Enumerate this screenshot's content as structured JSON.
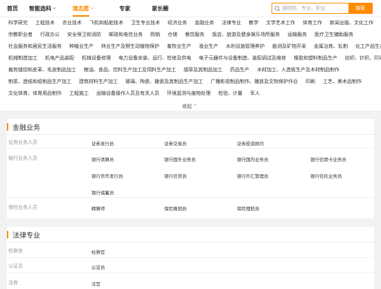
{
  "nav": {
    "items": [
      {
        "label": "首页"
      },
      {
        "label": "智能选科",
        "dropdown": true
      },
      {
        "label": "填志愿",
        "dropdown": true,
        "active": true
      },
      {
        "label": "专家"
      },
      {
        "label": "家长圈"
      }
    ]
  },
  "search": {
    "placeholder": "搜院校、专业、职业",
    "button_label": "搜索"
  },
  "categories": {
    "rows": [
      [
        "科学研究",
        "工程技术",
        "农业技术",
        "飞机和船舶技术",
        "卫生专业技术",
        "经济业务",
        "金融业务",
        "法律专业",
        "教学",
        "文学艺术工作",
        "体育工作",
        "新闻出版、文化工作"
      ],
      [
        "宗教职业者",
        "行政办公",
        "安全保卫和消防",
        "邮政和电信业务",
        "购销",
        "仓储",
        "餐饮服务",
        "饭店、旅游及健身娱乐场所服务",
        "运输服务",
        "医疗卫生辅助服务"
      ],
      [
        "社会服务和居民生活服务",
        "种植业生产",
        "林业生产及野生动植物保护",
        "畜牧业生产",
        "渔业生产",
        "水利设施管理养护",
        "勘测及矿物开采",
        "金属冶炼、轧制",
        "化工产品生产能力"
      ],
      [
        "机械制造加工",
        "机电产品装配",
        "机械设备修理",
        "电力设备安装、运行、检修及供电",
        "电子元器件与设备制造、装配调试及维修",
        "橡胶和塑料制品生产",
        "纺织、针织、印染"
      ],
      [
        "裁剪缝纫和皮革、毛皮制品加工",
        "粮油、食品、饮料生产加工及饲料生产加工",
        "烟草及其制品加工",
        "药品生产",
        "木材加工、人造板生产及木材制品制作"
      ],
      [
        "制浆、造纸和纸制品生产加工",
        "建筑材料生产加工",
        "玻璃、陶瓷、搪瓷及其制品生产加工",
        "广播影视制品制作、播放及文物保护作业",
        "印刷",
        "工艺、美术品制作"
      ],
      [
        "文化体育、体育用品制作",
        "工程施工",
        "运输设备操作人员及有关人员",
        "环境监测与废物处理",
        "检验、计量",
        "军人"
      ]
    ],
    "collapse_label": "收起"
  },
  "sections": [
    {
      "title": "金融业务",
      "groups": [
        {
          "label": "证券业务人员",
          "jobs": [
            "证券发行员",
            "证券交易员",
            "证券投资顾问"
          ]
        },
        {
          "label": "银行业务人员",
          "jobs": [
            "银行清算员",
            "银行国外业务员",
            "银行国内业务员",
            "银行信用卡业务员",
            "银行货币发行员",
            "银行信贷员",
            "银行外汇管理员",
            "银行信托业务员",
            "银行储蓄员"
          ]
        },
        {
          "label": "保险业务人员",
          "jobs": [
            "精算师",
            "保险推销员",
            "保险理赔员"
          ]
        }
      ]
    },
    {
      "title": "法律专业",
      "groups": [
        {
          "label": "检察官",
          "jobs": [
            "检察官"
          ]
        },
        {
          "label": "公证员",
          "jobs": [
            "公证员"
          ]
        },
        {
          "label": "法官",
          "jobs": [
            "法官"
          ]
        }
      ]
    }
  ]
}
